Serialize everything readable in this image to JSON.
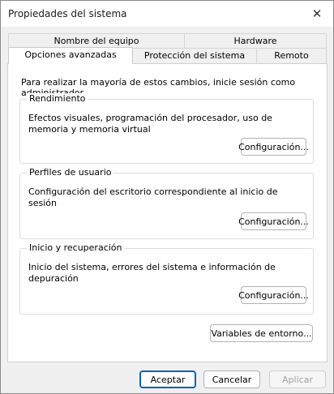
{
  "window": {
    "title": "Propiedades del sistema"
  },
  "tabs": {
    "top_row": [
      "Nombre del equipo",
      "Hardware"
    ],
    "bottom_row": [
      "Opciones avanzadas",
      "Protección del sistema",
      "Remoto"
    ],
    "active": "Opciones avanzadas"
  },
  "panel": {
    "intro": "Para realizar la mayoría de estos cambios, inicie sesión como administrador.",
    "groups": [
      {
        "title": "Rendimiento",
        "text": "Efectos visuales, programación del procesador, uso de memoria y memoria virtual",
        "button": "Configuración..."
      },
      {
        "title": "Perfiles de usuario",
        "text": "Configuración del escritorio correspondiente al inicio de sesión",
        "button": "Configuración..."
      },
      {
        "title": "Inicio y recuperación",
        "text": "Inicio del sistema, errores del sistema e información de depuración",
        "button": "Configuración..."
      }
    ],
    "env_button": "Variables de entorno..."
  },
  "footer": {
    "accept": "Aceptar",
    "cancel": "Cancelar",
    "apply": "Aplicar"
  },
  "colors": {
    "accent": "#005fb8",
    "panel_bg": "#ffffff",
    "dialog_bg": "#f0f0f0"
  }
}
